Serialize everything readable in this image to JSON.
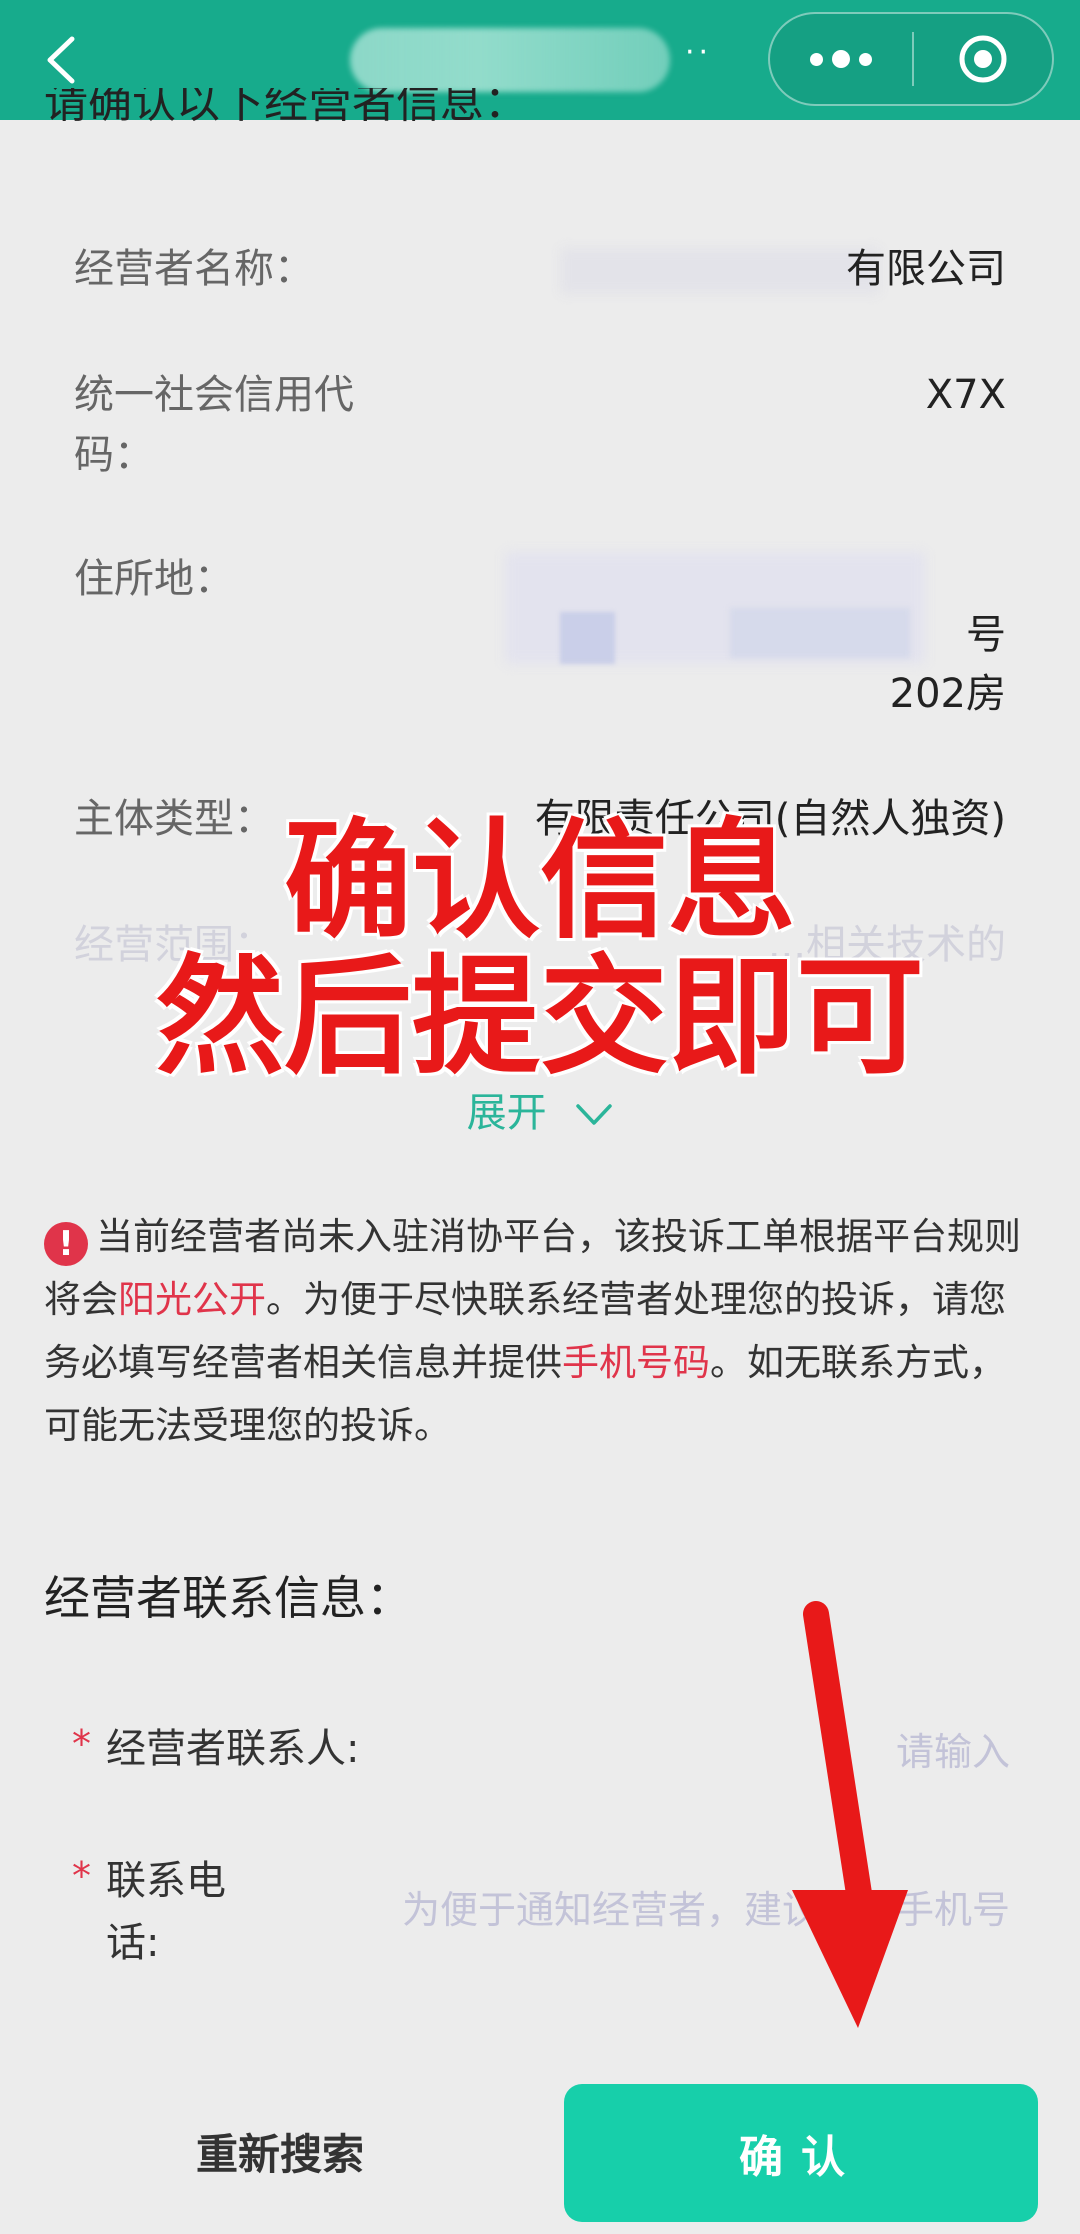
{
  "header": {
    "title_suffix": "··",
    "colors": {
      "bar": "#17ab8c"
    }
  },
  "content": {
    "heading_partial": "请确认以下经营者信息：",
    "fields": [
      {
        "label": "经营者名称：",
        "value": "有限公司"
      },
      {
        "label": "统一社会信用代码：",
        "label_line1": "统一社会信用代",
        "label_line2": "码：",
        "value": "X7X"
      },
      {
        "label": "住所地：",
        "value_line1": "号",
        "value_line2": "202房"
      },
      {
        "label": "主体类型：",
        "value": "有限责任公司(自然人独资)"
      },
      {
        "label": "经营范围：",
        "value": "...相关技术的"
      }
    ],
    "expand_label": "展开",
    "notice": {
      "part1": "当前经营者尚未入驻消协平台，该投诉工单根据平台规则将会",
      "highlight1": "阳光公开",
      "part2": "。为便于尽快联系经营者处理您的投诉，请您务必填写经营者相关信息并提供",
      "highlight2": "手机号码",
      "part3": "。如无联系方式，可能无法受理您的投诉。"
    },
    "contact_section": {
      "title": "经营者联系信息：",
      "contact_person": {
        "label": "经营者联系人:",
        "placeholder": "请输入"
      },
      "contact_phone": {
        "label_line1": "联系电",
        "label_line2": "话:",
        "placeholder": "为便于通知经营者，建议填写手机号"
      }
    }
  },
  "overlay": {
    "line1": "确认信息",
    "line2": "然后提交即可",
    "color": "#e81919"
  },
  "bottom_bar": {
    "research_label": "重新搜索",
    "confirm_label": "确认",
    "confirm_color": "#17cfaa"
  }
}
